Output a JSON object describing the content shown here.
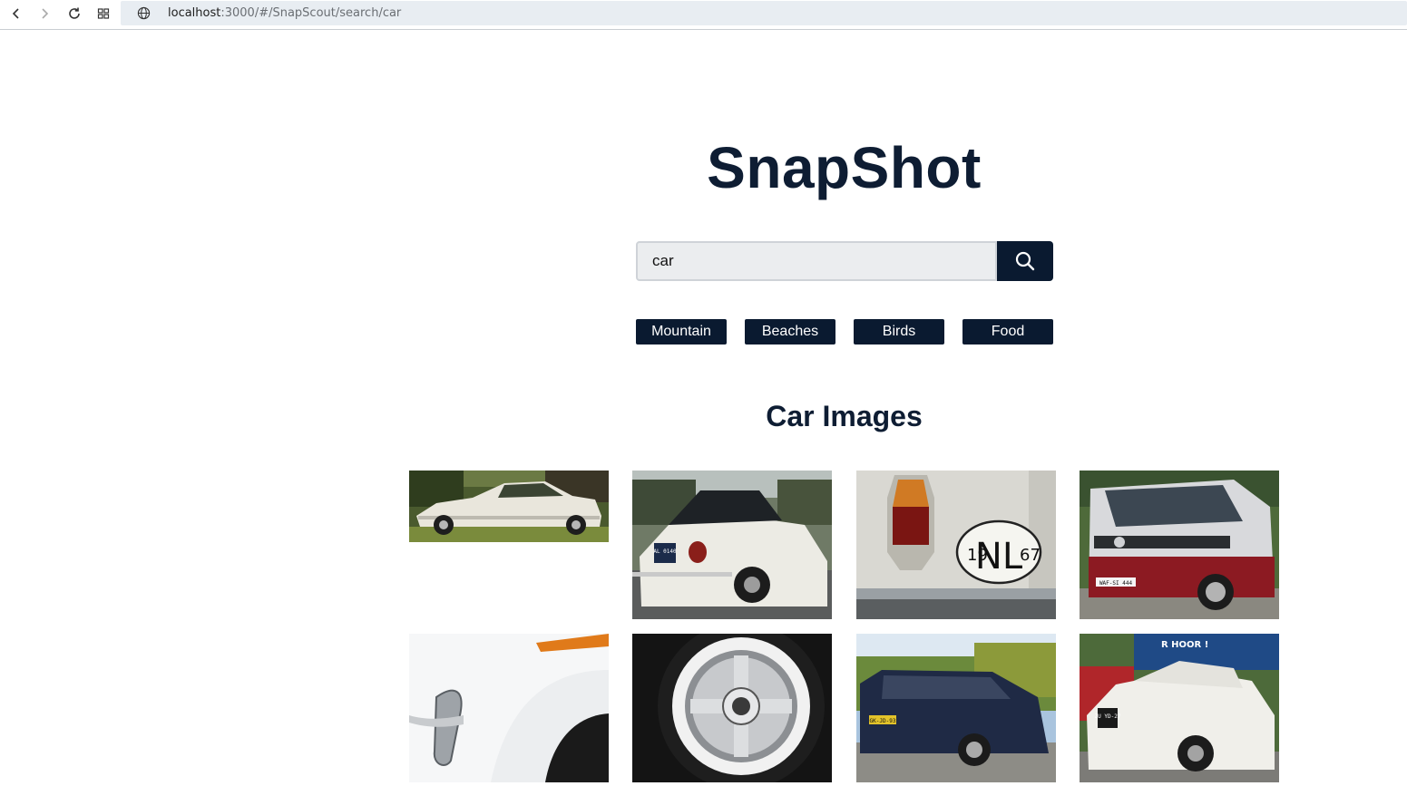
{
  "browser": {
    "url_host": "localhost",
    "url_path": ":3000/#/SnapScout/search/car"
  },
  "app": {
    "title": "SnapShot"
  },
  "search": {
    "value": "car"
  },
  "categories": [
    {
      "label": "Mountain"
    },
    {
      "label": "Beaches"
    },
    {
      "label": "Birds"
    },
    {
      "label": "Food"
    }
  ],
  "results": {
    "heading": "Car Images"
  },
  "photo_text": {
    "plate_beetle": "AL 0140",
    "oval_left": "19",
    "oval_center": "NL",
    "oval_right": "67",
    "plate_van": "WAF-SI 444",
    "plate_volvo": "GK-JD-93",
    "plate_beetle2": "ZU YD-27",
    "sign_text": "R HOOR !"
  },
  "icons": {
    "back": "arrow-left-icon",
    "forward": "arrow-right-icon",
    "reload": "reload-icon",
    "apps": "grid-icon",
    "site": "globe-icon",
    "search": "search-icon"
  },
  "colors": {
    "brand_navy": "#0a1a30",
    "title_text": "#0e1d33",
    "input_bg": "#ebedef"
  }
}
